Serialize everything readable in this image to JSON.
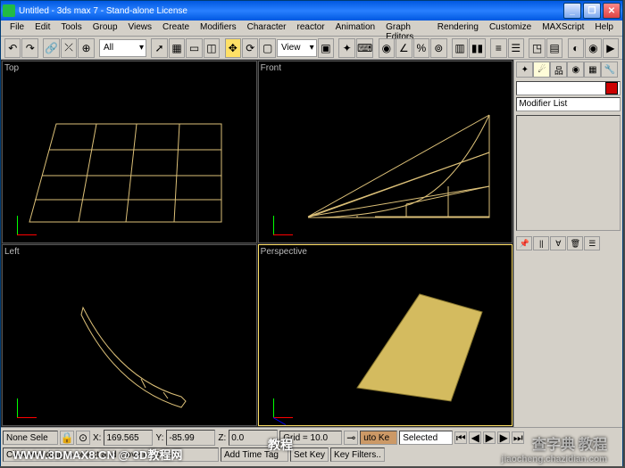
{
  "window": {
    "title": "Untitled - 3ds max 7 - Stand-alone License"
  },
  "menu": [
    "File",
    "Edit",
    "Tools",
    "Group",
    "Views",
    "Create",
    "Modifiers",
    "Character",
    "reactor",
    "Animation",
    "Graph Editors",
    "Rendering",
    "Customize",
    "MAXScript",
    "Help"
  ],
  "toolbar1": {
    "selector_value": "All",
    "view_dropdown": "View"
  },
  "viewports": {
    "top": "Top",
    "front": "Front",
    "left": "Left",
    "perspective": "Perspective"
  },
  "rightpanel": {
    "name_field": "",
    "modifier_list": "Modifier List",
    "color": "#cc0000"
  },
  "status": {
    "selection": "None Sele",
    "x": "169.565",
    "y": "-85.99",
    "z": "0.0",
    "grid": "Grid = 10.0",
    "prompt": "Click and drag to select and move objects",
    "timetag": "Add Time Tag",
    "auto_key": "uto Ke",
    "set_key": "Set Key",
    "key_filters": "Key Filters..",
    "selected": "Selected"
  },
  "watermarks": {
    "w1": "WWW.3DMAX8.CN @ 3D教程网",
    "w2": "查字典 教程",
    "w3": "jiaocheng.chazidian.com",
    "w4": "教程"
  }
}
